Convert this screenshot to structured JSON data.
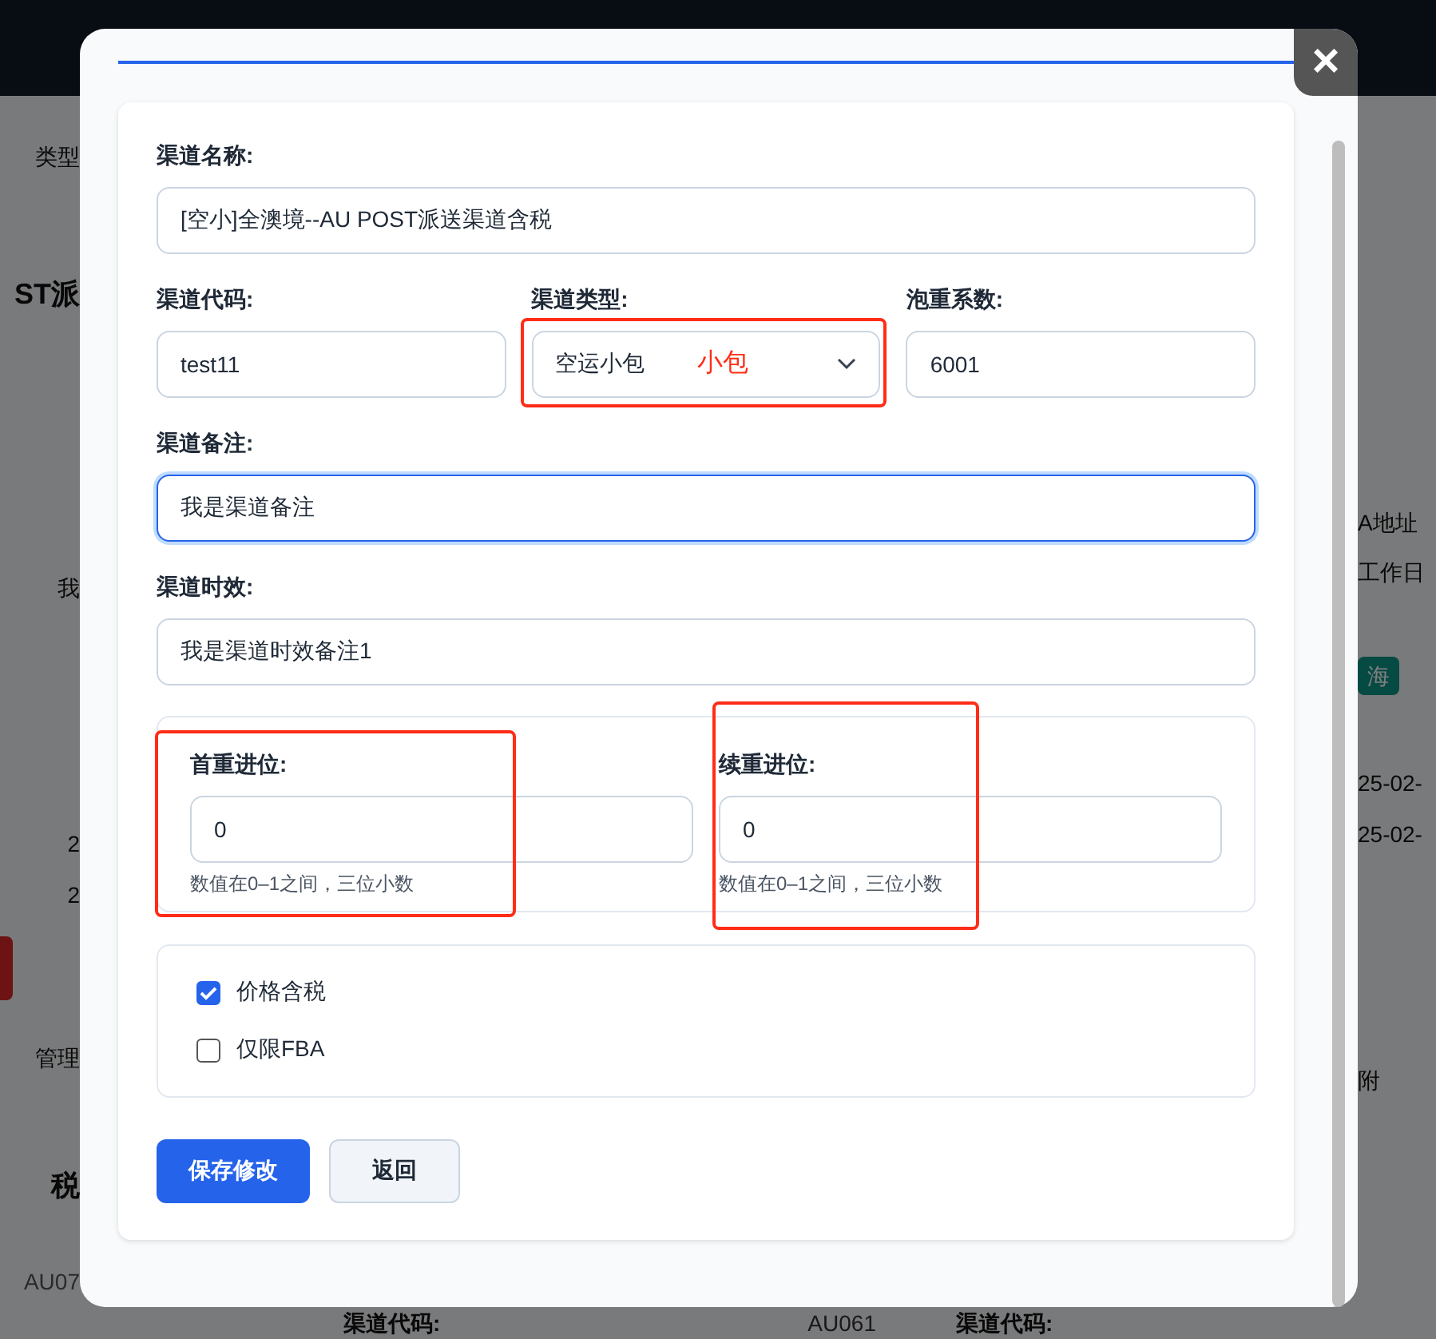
{
  "background": {
    "left": [
      {
        "text": "类型",
        "kind": "text"
      },
      {
        "text": "ST派",
        "kind": "heading"
      },
      {
        "text": "我",
        "kind": "text"
      },
      {
        "text": "2",
        "kind": "text"
      },
      {
        "text": "2",
        "kind": "text"
      },
      {
        "kind": "danger"
      },
      {
        "text": "管理",
        "kind": "tab"
      },
      {
        "text": "税",
        "kind": "heading"
      },
      {
        "text": "AU07",
        "kind": "code"
      }
    ],
    "right": [
      {
        "text": "A地址",
        "kind": "text"
      },
      {
        "text": "工作日",
        "kind": "text"
      },
      {
        "text": "海",
        "kind": "badge"
      },
      {
        "text": "25-02-",
        "kind": "text"
      },
      {
        "text": "25-02-",
        "kind": "text"
      },
      {
        "text": "附",
        "kind": "tab"
      }
    ],
    "bottom": [
      {
        "label": "渠道代码:",
        "value": "AU061"
      },
      {
        "label": "渠道代码:"
      }
    ]
  },
  "modal": {
    "close": "×",
    "fields": [
      {
        "label": "渠道名称:",
        "value": "[空小]全澳境--AU POST派送渠道含税",
        "kind": "input",
        "focused": false
      },
      {
        "row": [
          {
            "label": "渠道代码:",
            "value": "test11",
            "kind": "input",
            "focused": false
          },
          {
            "label": "渠道类型:",
            "value": "空运小包",
            "kind": "select",
            "focused": false,
            "highlighted": true,
            "annotation": "小包"
          },
          {
            "label": "泡重系数:",
            "value": "6001",
            "kind": "input",
            "focused": false
          }
        ]
      },
      {
        "label": "渠道备注:",
        "value": "我是渠道备注",
        "kind": "input",
        "focused": true
      },
      {
        "label": "渠道时效:",
        "value": "我是渠道时效备注1",
        "kind": "input",
        "focused": false
      }
    ],
    "rounding": [
      {
        "label": "首重进位:",
        "value": "0",
        "hint": "数值在0–1之间，三位小数",
        "highlighted": true
      },
      {
        "label": "续重进位:",
        "value": "0",
        "hint": "数值在0–1之间，三位小数",
        "highlighted": true
      }
    ],
    "checkboxes": [
      {
        "label": "价格含税",
        "checked": true
      },
      {
        "label": "仅限FBA",
        "checked": false
      }
    ],
    "buttons": [
      {
        "label": "保存修改",
        "kind": "primary"
      },
      {
        "label": "返回",
        "kind": "secondary"
      }
    ]
  }
}
